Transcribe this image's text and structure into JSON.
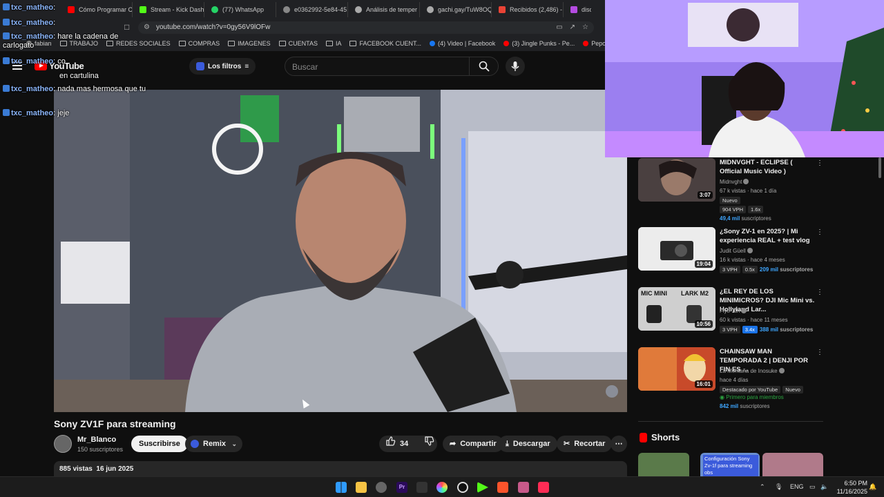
{
  "browser": {
    "tabs": [
      {
        "label": "Cómo Programar C",
        "color": "#ff0000"
      },
      {
        "label": "Stream - Kick Dash",
        "color": "#53fc18"
      },
      {
        "label": "(77) WhatsApp",
        "color": "#25d366"
      },
      {
        "label": "e0362992-5e84-45",
        "color": "#888888"
      },
      {
        "label": "Análisis de temper",
        "color": "#aaaaaa"
      },
      {
        "label": "gachi.gay/TuW8OQ",
        "color": "#aaaaaa"
      },
      {
        "label": "Recibidos (2,486) -",
        "color": "#ea4335"
      },
      {
        "label": "discor",
        "color": "#b44be1"
      }
    ],
    "url": "youtube.com/watch?v=0gy56V9lOFw",
    "bookmarks": [
      {
        "label": "fabian",
        "type": "icon"
      },
      {
        "label": "TRABAJO",
        "type": "folder"
      },
      {
        "label": "REDES SOCIALES",
        "type": "folder"
      },
      {
        "label": "COMPRAS",
        "type": "folder"
      },
      {
        "label": "IMAGENES",
        "type": "folder"
      },
      {
        "label": "CUENTAS",
        "type": "folder"
      },
      {
        "label": "IA",
        "type": "folder"
      },
      {
        "label": "FACEBOOK CUENT...",
        "type": "folder"
      },
      {
        "label": "(4) Video | Facebook",
        "type": "facebook"
      },
      {
        "label": "(3) Jingle Punks - Pe...",
        "type": "youtube"
      },
      {
        "label": "Pepo x @kazu.oficia...",
        "type": "youtube"
      }
    ]
  },
  "youtube": {
    "logo": "YouTube",
    "filters_label": "Los filtros",
    "search_placeholder": "Buscar"
  },
  "chat": [
    {
      "user": "txc_matheo",
      "text": ""
    },
    {
      "user": "txc_matheo",
      "text": ""
    },
    {
      "user": "txc_matheo",
      "text": "hare la cadena de carlogato"
    },
    {
      "user": "txc_matheo",
      "text": "co"
    },
    {
      "user": "",
      "text": "en cartulina"
    },
    {
      "user": "txc_matheo",
      "text": "nada mas hermosa que tu"
    },
    {
      "user": "txc_matheo",
      "text": "jeje"
    }
  ],
  "video": {
    "title": "Sony ZV1F para streaming",
    "channel": "Mr_Blanco",
    "subscribers": "150 suscriptores",
    "subscribe_label": "Suscribirse",
    "remix_label": "Remix",
    "likes": "34",
    "share_label": "Compartir",
    "download_label": "Descargar",
    "clip_label": "Recortar",
    "views": "885 vistas",
    "date": "16 jun 2025"
  },
  "recommendations": [
    {
      "title": "MIDNVGHT - ECLIPSE ( Official Music Video )",
      "channel": "Midnvght",
      "stats": "67 k vistas · hace 1 día",
      "tags": [
        "Nuevo"
      ],
      "vph": "904 VPH",
      "ratio": "1.6x",
      "subs_num": "49,4 mil",
      "subs_word": "suscriptores",
      "duration": "3:07",
      "thumb": "#4a4040"
    },
    {
      "title": "¿Sony ZV-1 en 2025? | Mi experiencia REAL + test vlog",
      "channel": "Judit Güell",
      "stats": "16 k vistas · hace 4 meses",
      "vph": "3 VPH",
      "ratio": "0.5x",
      "subs_num": "209 mil",
      "subs_word": "suscriptores",
      "duration": "19:04",
      "thumb": "#e8e8e8"
    },
    {
      "title": "¿EL REY DE LOS MINIMICROS? DJI Mic Mini vs. Hollyland Lar...",
      "channel": "FlytPath",
      "stats": "60 k vistas · hace 11 meses",
      "vph": "3 VPH",
      "ratio": "3.4x",
      "subs_num": "388 mil",
      "subs_word": "suscriptores",
      "duration": "10:56",
      "thumb": "#c8c8c8",
      "thumb_labels": [
        "MIC MINI",
        "LARK M2"
      ]
    },
    {
      "title": "CHAINSAW MAN TEMPORADA 2 | DENJI POR FIN ES ...",
      "channel": "La Montaña de Inosuke",
      "stats": "hace 4 días",
      "tags": [
        "Destacado por YouTube",
        "Nuevo"
      ],
      "members": "Primero para miembros",
      "subs_num": "842 mil",
      "subs_word": "suscriptores",
      "duration": "16:01",
      "thumb": "#c84a2a"
    }
  ],
  "shorts": {
    "label": "Shorts",
    "first_caption": "Configuración Sony Zv-1f para streaming obs"
  },
  "taskbar": {
    "lang": "ENG",
    "time": "6:50 PM",
    "date": "11/16/2025"
  }
}
